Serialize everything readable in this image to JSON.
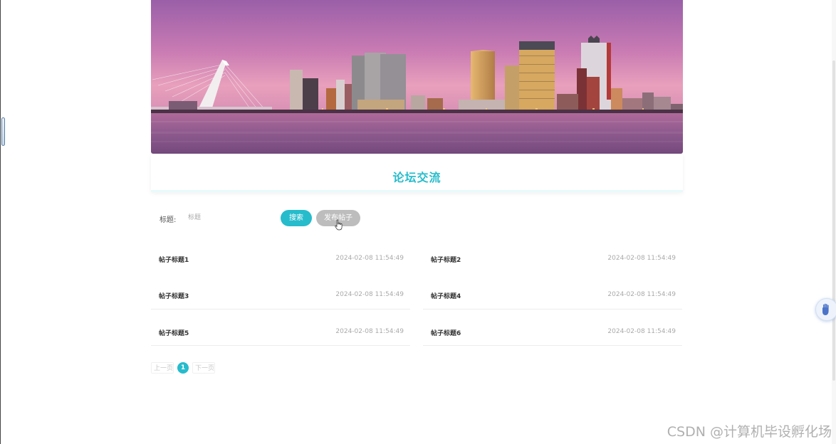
{
  "banner": {
    "alt_icon": "city-skyline-image"
  },
  "forum": {
    "title": "论坛交流"
  },
  "search": {
    "label": "标题:",
    "placeholder": "标题",
    "search_button": "搜索",
    "post_button": "发布帖子"
  },
  "posts": [
    {
      "title": "帖子标题1",
      "time": "2024-02-08 11:54:49"
    },
    {
      "title": "帖子标题2",
      "time": "2024-02-08 11:54:49"
    },
    {
      "title": "帖子标题3",
      "time": "2024-02-08 11:54:49"
    },
    {
      "title": "帖子标题4",
      "time": "2024-02-08 11:54:49"
    },
    {
      "title": "帖子标题5",
      "time": "2024-02-08 11:54:49"
    },
    {
      "title": "帖子标题6",
      "time": "2024-02-08 11:54:49"
    }
  ],
  "pagination": {
    "prev": "上一页",
    "current": "1",
    "next": "下一页"
  },
  "watermark": "CSDN @计算机毕设孵化场",
  "colors": {
    "accent": "#26bccc",
    "disabled_button": "#bdbdbd"
  }
}
